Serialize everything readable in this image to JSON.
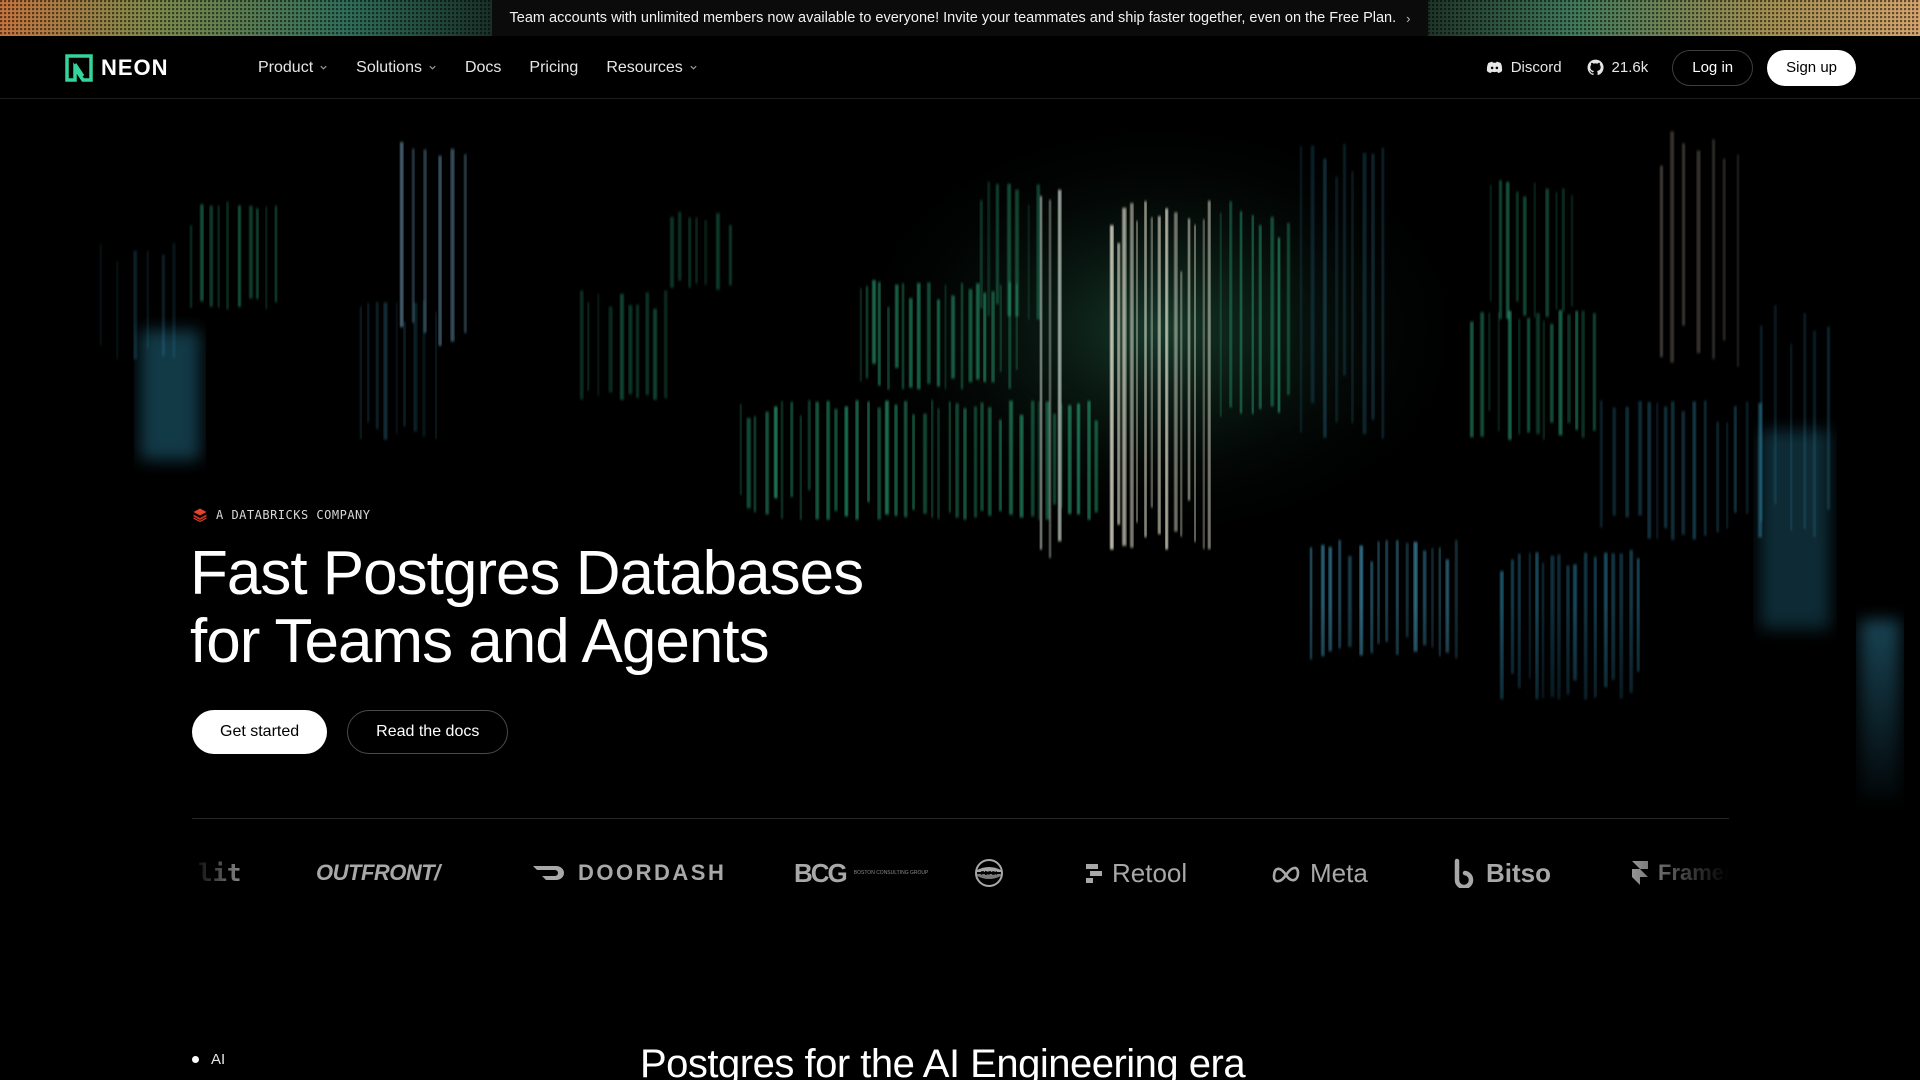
{
  "banner": {
    "text": "Team accounts with unlimited members now available to everyone! Invite your teammates and ship faster together, even on the Free Plan.",
    "chevron": "›"
  },
  "nav": {
    "logo_text": "NEON",
    "menu": [
      {
        "label": "Product",
        "has_dropdown": true
      },
      {
        "label": "Solutions",
        "has_dropdown": true
      },
      {
        "label": "Docs",
        "has_dropdown": false
      },
      {
        "label": "Pricing",
        "has_dropdown": false
      },
      {
        "label": "Resources",
        "has_dropdown": true
      }
    ],
    "discord_label": "Discord",
    "github_stars": "21.6k",
    "login_label": "Log in",
    "signup_label": "Sign up"
  },
  "hero": {
    "eyebrow": "A DATABRICKS COMPANY",
    "headline_line1": "Fast Postgres Databases",
    "headline_line2": "for Teams and Agents",
    "cta_primary": "Get started",
    "cta_secondary": "Read the docs"
  },
  "customers": {
    "slit": "lit",
    "outfront": "OUTFRONT/",
    "doordash": "DOORDASH",
    "bcg_big": "BCG",
    "bcg_small": "BOSTON CONSULTING GROUP",
    "pepsi": "PEPSI",
    "retool": "Retool",
    "meta": "Meta",
    "bitso": "Bitso",
    "framer": "Framer"
  },
  "next_section": {
    "tag": "AI",
    "title": "Postgres for the AI Engineering era"
  },
  "colors": {
    "accent_green": "#34d59a",
    "background": "#000000",
    "databricks_red": "#e8412c"
  }
}
